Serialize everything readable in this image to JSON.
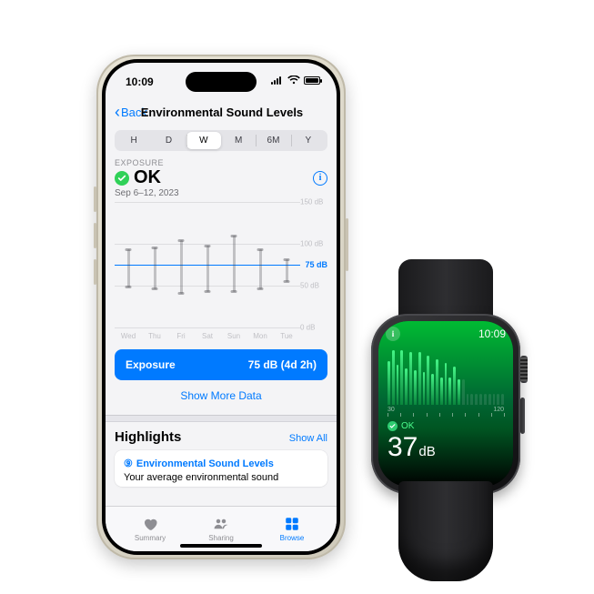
{
  "phone": {
    "status": {
      "time": "10:09"
    },
    "nav": {
      "back": "Back",
      "title": "Environmental Sound Levels"
    },
    "segments": [
      "H",
      "D",
      "W",
      "M",
      "6M",
      "Y"
    ],
    "segment_selected": "W",
    "exposure_label": "EXPOSURE",
    "status_text": "OK",
    "date_range": "Sep 6–12, 2023",
    "summary_card": {
      "label": "Exposure",
      "value": "75 dB (4d 2h)"
    },
    "show_more": "Show More Data",
    "highlights": {
      "heading": "Highlights",
      "show_all": "Show All",
      "card_title": "Environmental Sound Levels",
      "card_sub": "Your average environmental sound"
    },
    "tabs": [
      "Summary",
      "Sharing",
      "Browse"
    ]
  },
  "chart_data": {
    "type": "bar",
    "unit": "dB",
    "y_ticks": [
      0,
      50,
      100,
      150
    ],
    "y_tick_labels": [
      "0 dB",
      "50 dB",
      "100 dB",
      "150 dB"
    ],
    "threshold": 75,
    "threshold_label": "75 dB",
    "categories": [
      "Wed",
      "Thu",
      "Fri",
      "Sat",
      "Sun",
      "Mon",
      "Tue"
    ],
    "series": [
      {
        "name": "range_low",
        "values": [
          48,
          46,
          40,
          42,
          42,
          46,
          54
        ]
      },
      {
        "name": "range_high",
        "values": [
          94,
          96,
          104,
          98,
          110,
          94,
          82
        ]
      }
    ]
  },
  "watch": {
    "time": "10:09",
    "scale": {
      "min": "30",
      "max": "120"
    },
    "status": "OK",
    "value": "37",
    "unit": "dB",
    "bars": [
      48,
      60,
      44,
      60,
      40,
      58,
      38,
      58,
      36,
      54,
      34,
      50,
      30,
      46,
      30,
      42,
      28,
      28,
      12,
      12,
      12,
      12,
      12,
      12,
      12,
      12,
      12
    ]
  }
}
